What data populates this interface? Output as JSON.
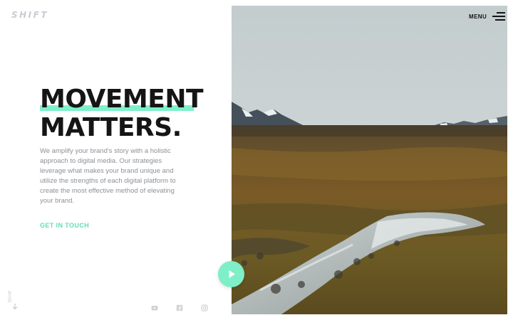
{
  "header": {
    "logo_text": "SHIFT",
    "menu_label": "MENU",
    "menu_icon": "hamburger-icon"
  },
  "hero": {
    "title_line_1": "MOVEMENT",
    "title_line_2": "MATTERS.",
    "body": "We amplify your brand's story with a holistic approach to digital media. Our strategies leverage what makes your brand unique and utilize the strengths of each digital platform to create the most effective method of elevating your brand.",
    "cta_label": "GET IN TOUCH",
    "image_alt_icon": "landscape-photo",
    "play_icon": "play-icon"
  },
  "sidebar": {
    "scroll_label": "Scroll",
    "scroll_icon": "arrow-down-icon"
  },
  "social": [
    {
      "icon": "youtube-icon"
    },
    {
      "icon": "facebook-icon"
    },
    {
      "icon": "instagram-icon"
    }
  ],
  "colors": {
    "accent": "#7ff0cc",
    "cta": "#5ce0b8",
    "title": "#151515",
    "body_text": "#8c9096"
  }
}
